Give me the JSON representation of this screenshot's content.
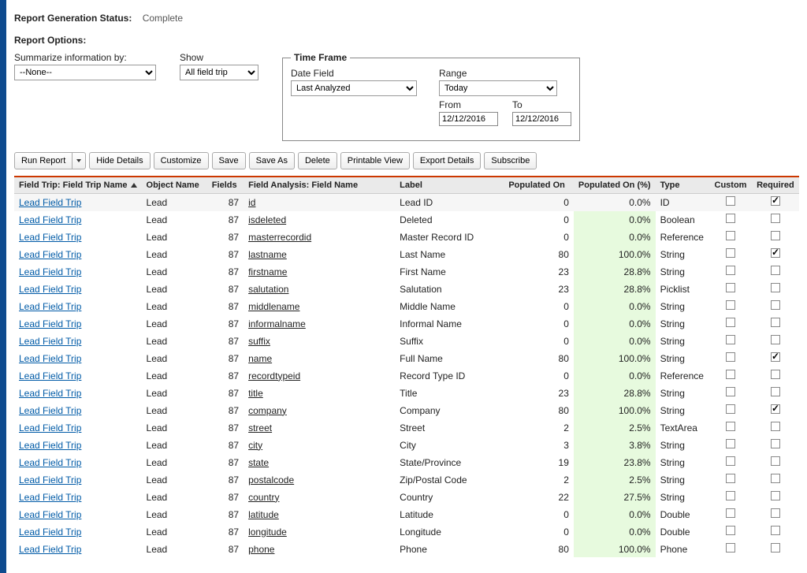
{
  "status": {
    "label": "Report Generation Status:",
    "value": "Complete"
  },
  "options": {
    "heading": "Report Options:",
    "summarize_label": "Summarize information by:",
    "summarize_value": "--None--",
    "show_label": "Show",
    "show_value": "All field trip"
  },
  "timeframe": {
    "legend": "Time Frame",
    "date_field_label": "Date Field",
    "date_field_value": "Last Analyzed",
    "range_label": "Range",
    "range_value": "Today",
    "from_label": "From",
    "from_value": "12/12/2016",
    "to_label": "To",
    "to_value": "12/12/2016"
  },
  "toolbar": {
    "run": "Run Report",
    "hide": "Hide Details",
    "customize": "Customize",
    "save": "Save",
    "saveas": "Save As",
    "delete": "Delete",
    "printable": "Printable View",
    "export": "Export Details",
    "subscribe": "Subscribe"
  },
  "columns": {
    "trip": "Field Trip: Field Trip Name",
    "object": "Object Name",
    "fields": "Fields",
    "analysis": "Field Analysis: Field Name",
    "label": "Label",
    "pop_on": "Populated On",
    "pop_pct": "Populated On (%)",
    "type": "Type",
    "custom": "Custom",
    "required": "Required"
  },
  "rows": [
    {
      "trip": "Lead Field Trip",
      "object": "Lead",
      "fields": "87",
      "analysis": "id",
      "label": "Lead ID",
      "pop_on": "0",
      "pop_pct": "0.0%",
      "type": "ID",
      "custom": false,
      "required": true
    },
    {
      "trip": "Lead Field Trip",
      "object": "Lead",
      "fields": "87",
      "analysis": "isdeleted",
      "label": "Deleted",
      "pop_on": "0",
      "pop_pct": "0.0%",
      "type": "Boolean",
      "custom": false,
      "required": false
    },
    {
      "trip": "Lead Field Trip",
      "object": "Lead",
      "fields": "87",
      "analysis": "masterrecordid",
      "label": "Master Record ID",
      "pop_on": "0",
      "pop_pct": "0.0%",
      "type": "Reference",
      "custom": false,
      "required": false
    },
    {
      "trip": "Lead Field Trip",
      "object": "Lead",
      "fields": "87",
      "analysis": "lastname",
      "label": "Last Name",
      "pop_on": "80",
      "pop_pct": "100.0%",
      "type": "String",
      "custom": false,
      "required": true
    },
    {
      "trip": "Lead Field Trip",
      "object": "Lead",
      "fields": "87",
      "analysis": "firstname",
      "label": "First Name",
      "pop_on": "23",
      "pop_pct": "28.8%",
      "type": "String",
      "custom": false,
      "required": false
    },
    {
      "trip": "Lead Field Trip",
      "object": "Lead",
      "fields": "87",
      "analysis": "salutation",
      "label": "Salutation",
      "pop_on": "23",
      "pop_pct": "28.8%",
      "type": "Picklist",
      "custom": false,
      "required": false
    },
    {
      "trip": "Lead Field Trip",
      "object": "Lead",
      "fields": "87",
      "analysis": "middlename",
      "label": "Middle Name",
      "pop_on": "0",
      "pop_pct": "0.0%",
      "type": "String",
      "custom": false,
      "required": false
    },
    {
      "trip": "Lead Field Trip",
      "object": "Lead",
      "fields": "87",
      "analysis": "informalname",
      "label": "Informal Name",
      "pop_on": "0",
      "pop_pct": "0.0%",
      "type": "String",
      "custom": false,
      "required": false
    },
    {
      "trip": "Lead Field Trip",
      "object": "Lead",
      "fields": "87",
      "analysis": "suffix",
      "label": "Suffix",
      "pop_on": "0",
      "pop_pct": "0.0%",
      "type": "String",
      "custom": false,
      "required": false
    },
    {
      "trip": "Lead Field Trip",
      "object": "Lead",
      "fields": "87",
      "analysis": "name",
      "label": "Full Name",
      "pop_on": "80",
      "pop_pct": "100.0%",
      "type": "String",
      "custom": false,
      "required": true
    },
    {
      "trip": "Lead Field Trip",
      "object": "Lead",
      "fields": "87",
      "analysis": "recordtypeid",
      "label": "Record Type ID",
      "pop_on": "0",
      "pop_pct": "0.0%",
      "type": "Reference",
      "custom": false,
      "required": false
    },
    {
      "trip": "Lead Field Trip",
      "object": "Lead",
      "fields": "87",
      "analysis": "title",
      "label": "Title",
      "pop_on": "23",
      "pop_pct": "28.8%",
      "type": "String",
      "custom": false,
      "required": false
    },
    {
      "trip": "Lead Field Trip",
      "object": "Lead",
      "fields": "87",
      "analysis": "company",
      "label": "Company",
      "pop_on": "80",
      "pop_pct": "100.0%",
      "type": "String",
      "custom": false,
      "required": true
    },
    {
      "trip": "Lead Field Trip",
      "object": "Lead",
      "fields": "87",
      "analysis": "street",
      "label": "Street",
      "pop_on": "2",
      "pop_pct": "2.5%",
      "type": "TextArea",
      "custom": false,
      "required": false
    },
    {
      "trip": "Lead Field Trip",
      "object": "Lead",
      "fields": "87",
      "analysis": "city",
      "label": "City",
      "pop_on": "3",
      "pop_pct": "3.8%",
      "type": "String",
      "custom": false,
      "required": false
    },
    {
      "trip": "Lead Field Trip",
      "object": "Lead",
      "fields": "87",
      "analysis": "state",
      "label": "State/Province",
      "pop_on": "19",
      "pop_pct": "23.8%",
      "type": "String",
      "custom": false,
      "required": false
    },
    {
      "trip": "Lead Field Trip",
      "object": "Lead",
      "fields": "87",
      "analysis": "postalcode",
      "label": "Zip/Postal Code",
      "pop_on": "2",
      "pop_pct": "2.5%",
      "type": "String",
      "custom": false,
      "required": false
    },
    {
      "trip": "Lead Field Trip",
      "object": "Lead",
      "fields": "87",
      "analysis": "country",
      "label": "Country",
      "pop_on": "22",
      "pop_pct": "27.5%",
      "type": "String",
      "custom": false,
      "required": false
    },
    {
      "trip": "Lead Field Trip",
      "object": "Lead",
      "fields": "87",
      "analysis": "latitude",
      "label": "Latitude",
      "pop_on": "0",
      "pop_pct": "0.0%",
      "type": "Double",
      "custom": false,
      "required": false
    },
    {
      "trip": "Lead Field Trip",
      "object": "Lead",
      "fields": "87",
      "analysis": "longitude",
      "label": "Longitude",
      "pop_on": "0",
      "pop_pct": "0.0%",
      "type": "Double",
      "custom": false,
      "required": false
    },
    {
      "trip": "Lead Field Trip",
      "object": "Lead",
      "fields": "87",
      "analysis": "phone",
      "label": "Phone",
      "pop_on": "80",
      "pop_pct": "100.0%",
      "type": "Phone",
      "custom": false,
      "required": false
    }
  ]
}
